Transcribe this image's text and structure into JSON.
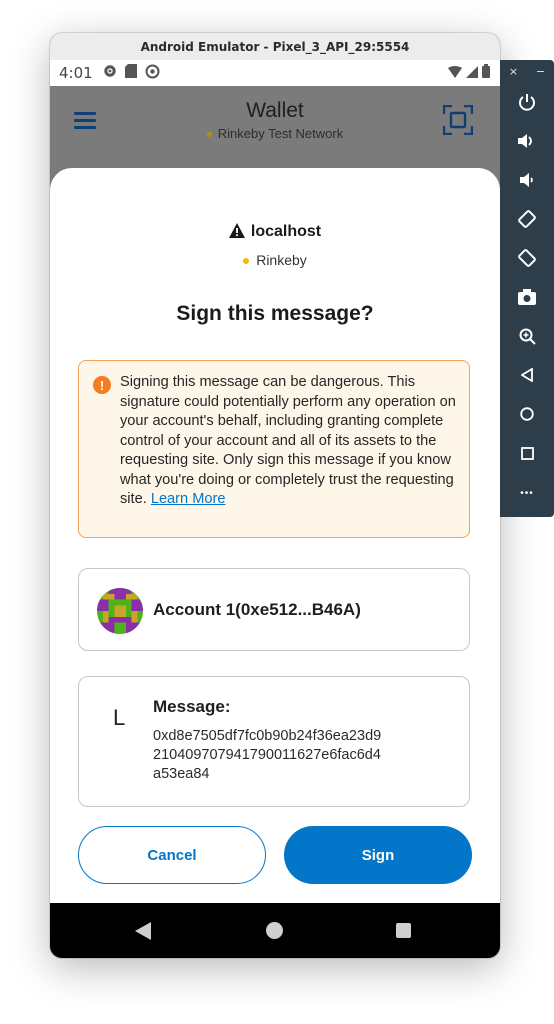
{
  "emulator": {
    "window_title": "Android Emulator - Pixel_3_API_29:5554"
  },
  "status_bar": {
    "time": "4:01"
  },
  "app_header": {
    "title": "Wallet",
    "network": "Rinkeby Test Network"
  },
  "sheet": {
    "origin": "localhost",
    "chain": "Rinkeby",
    "title": "Sign this message?",
    "warning": {
      "text": "Signing this message can be dangerous. This signature could potentially perform any operation on your account's behalf, including granting complete control of your account and all of its assets to the requesting site. Only sign this message if you know what you're doing or completely trust the requesting site.",
      "link_label": "Learn More"
    },
    "account": {
      "label": "Account 1(0xe512...B46A)"
    },
    "message": {
      "glyph": "L",
      "label": "Message:",
      "lines": [
        "0xd8e7505df7fc0b90b24f36ea23d9",
        "210409707941790011627e6fac6d4",
        "a53ea84"
      ]
    },
    "buttons": {
      "cancel": "Cancel",
      "sign": "Sign"
    }
  },
  "side_toolbar": {
    "close_glyph": "×",
    "minimize_glyph": "−",
    "more_glyph": "•••"
  },
  "colors": {
    "accent": "#0376c9",
    "warning_border": "#f3a25a",
    "warning_bg": "#fef7e9",
    "warning_icon": "#f57c1f",
    "chain_dot": "#f6b800"
  }
}
